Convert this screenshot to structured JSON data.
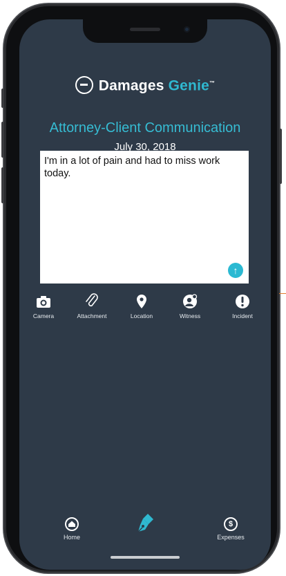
{
  "app": {
    "brand_primary": "Damages",
    "brand_accent": "Genie",
    "trademark": "™",
    "title": "Attorney-Client Communication",
    "date": "July 30, 2018"
  },
  "message": {
    "text": "I'm in a lot of pain and had to miss work today."
  },
  "tools": [
    {
      "label": "Camera",
      "icon": "camera-icon"
    },
    {
      "label": "Attachment",
      "icon": "paperclip-icon"
    },
    {
      "label": "Location",
      "icon": "location-pin-icon"
    },
    {
      "label": "Witness",
      "icon": "witness-icon"
    },
    {
      "label": "Incident",
      "icon": "alert-icon"
    }
  ],
  "nav": {
    "home": "Home",
    "expenses": "Expenses"
  },
  "colors": {
    "background": "#2e3a48",
    "accent": "#2fb8d0",
    "phone": "#0e0f11"
  }
}
